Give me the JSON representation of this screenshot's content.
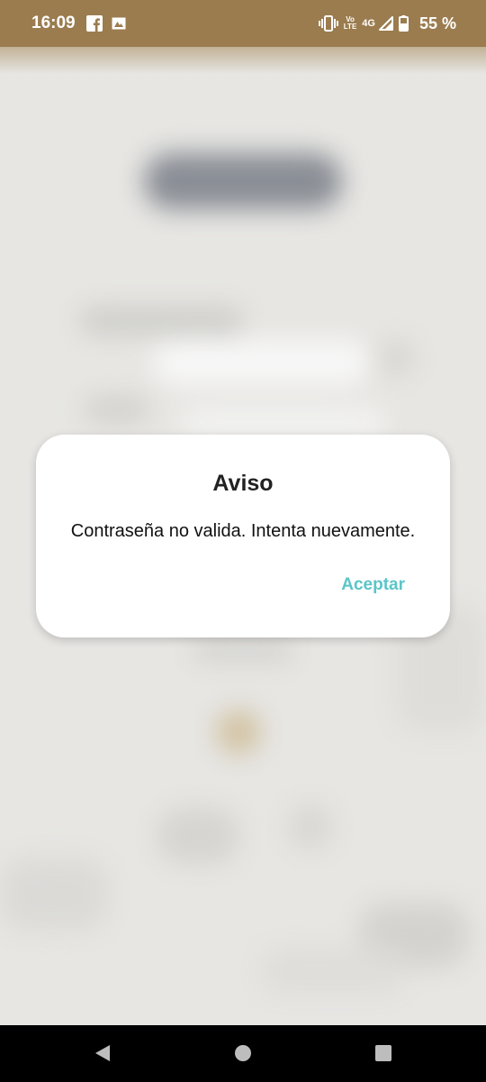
{
  "status_bar": {
    "time": "16:09",
    "notification_icons": [
      "facebook-icon",
      "image-notification-icon"
    ],
    "vo_label": "Vo",
    "lte_label": "LTE",
    "network": "4G",
    "battery": "55 %",
    "background_color": "#9b7c4f"
  },
  "dialog": {
    "title": "Aviso",
    "message": "Contraseña no valida. Intenta nuevamente.",
    "accept_label": "Aceptar",
    "accent_color": "#5cc5c8"
  },
  "nav_bar": {
    "buttons": [
      "back-icon",
      "home-icon",
      "recents-icon"
    ]
  }
}
